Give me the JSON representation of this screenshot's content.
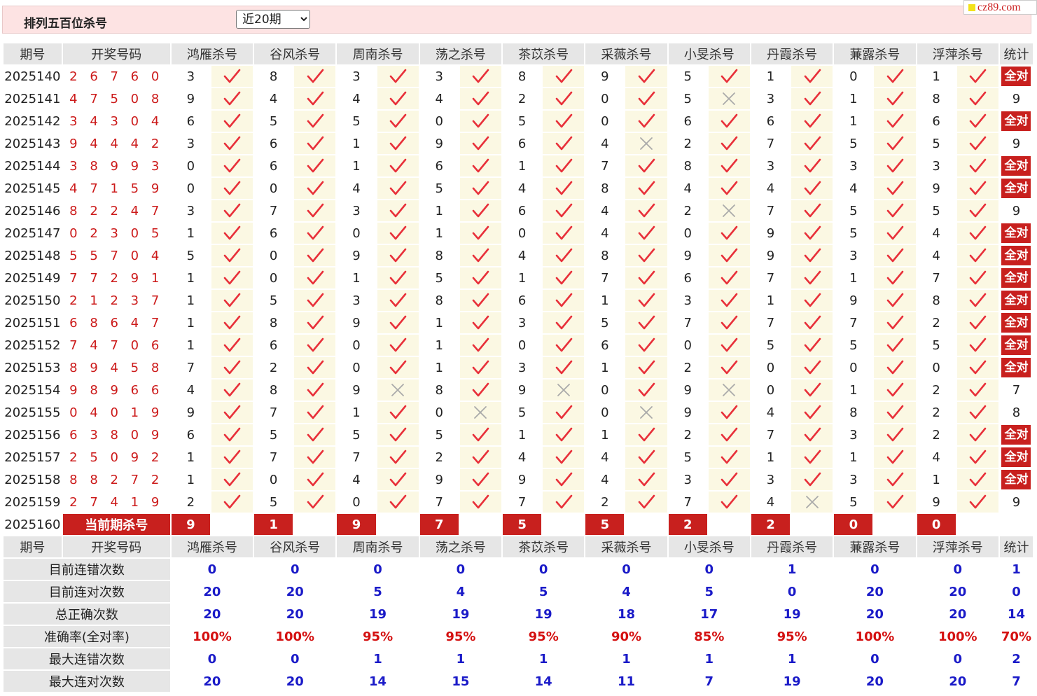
{
  "header": {
    "title": "排列五百位杀号",
    "period_select": "近20期"
  },
  "brand": "cz89.com",
  "columns": {
    "period": "期号",
    "draw": "开奖号码",
    "experts": [
      "鸿雁杀号",
      "谷风杀号",
      "周南杀号",
      "荡之杀号",
      "茶苡杀号",
      "采薇杀号",
      "小旻杀号",
      "丹霞杀号",
      "蒹露杀号",
      "浮萍杀号"
    ],
    "stat": "统计"
  },
  "rows": [
    {
      "period": "2025140",
      "draw": "2 6 7 6 0",
      "kills": [
        "3",
        "8",
        "3",
        "3",
        "8",
        "9",
        "5",
        "1",
        "0",
        "1"
      ],
      "hits": [
        1,
        1,
        1,
        1,
        1,
        1,
        1,
        1,
        1,
        1
      ],
      "stat": "全对"
    },
    {
      "period": "2025141",
      "draw": "4 7 5 0 8",
      "kills": [
        "9",
        "4",
        "4",
        "4",
        "2",
        "0",
        "5",
        "3",
        "1",
        "8"
      ],
      "hits": [
        1,
        1,
        1,
        1,
        1,
        1,
        0,
        1,
        1,
        1
      ],
      "stat": "9"
    },
    {
      "period": "2025142",
      "draw": "3 4 3 0 4",
      "kills": [
        "6",
        "5",
        "5",
        "0",
        "5",
        "0",
        "6",
        "6",
        "1",
        "6"
      ],
      "hits": [
        1,
        1,
        1,
        1,
        1,
        1,
        1,
        1,
        1,
        1
      ],
      "stat": "全对"
    },
    {
      "period": "2025143",
      "draw": "9 4 4 4 2",
      "kills": [
        "3",
        "6",
        "1",
        "9",
        "6",
        "4",
        "2",
        "7",
        "5",
        "5"
      ],
      "hits": [
        1,
        1,
        1,
        1,
        1,
        0,
        1,
        1,
        1,
        1
      ],
      "stat": "9"
    },
    {
      "period": "2025144",
      "draw": "3 8 9 9 3",
      "kills": [
        "0",
        "6",
        "1",
        "6",
        "1",
        "7",
        "8",
        "3",
        "3",
        "3"
      ],
      "hits": [
        1,
        1,
        1,
        1,
        1,
        1,
        1,
        1,
        1,
        1
      ],
      "stat": "全对"
    },
    {
      "period": "2025145",
      "draw": "4 7 1 5 9",
      "kills": [
        "0",
        "0",
        "4",
        "5",
        "4",
        "8",
        "4",
        "4",
        "4",
        "9"
      ],
      "hits": [
        1,
        1,
        1,
        1,
        1,
        1,
        1,
        1,
        1,
        1
      ],
      "stat": "全对"
    },
    {
      "period": "2025146",
      "draw": "8 2 2 4 7",
      "kills": [
        "3",
        "7",
        "3",
        "1",
        "6",
        "4",
        "2",
        "7",
        "5",
        "5"
      ],
      "hits": [
        1,
        1,
        1,
        1,
        1,
        1,
        0,
        1,
        1,
        1
      ],
      "stat": "9"
    },
    {
      "period": "2025147",
      "draw": "0 2 3 0 5",
      "kills": [
        "1",
        "6",
        "0",
        "1",
        "0",
        "4",
        "0",
        "9",
        "5",
        "4"
      ],
      "hits": [
        1,
        1,
        1,
        1,
        1,
        1,
        1,
        1,
        1,
        1
      ],
      "stat": "全对"
    },
    {
      "period": "2025148",
      "draw": "5 5 7 0 4",
      "kills": [
        "5",
        "0",
        "9",
        "8",
        "4",
        "8",
        "9",
        "9",
        "3",
        "4"
      ],
      "hits": [
        1,
        1,
        1,
        1,
        1,
        1,
        1,
        1,
        1,
        1
      ],
      "stat": "全对"
    },
    {
      "period": "2025149",
      "draw": "7 7 2 9 1",
      "kills": [
        "1",
        "0",
        "1",
        "5",
        "1",
        "7",
        "6",
        "7",
        "1",
        "7"
      ],
      "hits": [
        1,
        1,
        1,
        1,
        1,
        1,
        1,
        1,
        1,
        1
      ],
      "stat": "全对"
    },
    {
      "period": "2025150",
      "draw": "2 1 2 3 7",
      "kills": [
        "1",
        "5",
        "3",
        "8",
        "6",
        "1",
        "3",
        "1",
        "9",
        "8"
      ],
      "hits": [
        1,
        1,
        1,
        1,
        1,
        1,
        1,
        1,
        1,
        1
      ],
      "stat": "全对"
    },
    {
      "period": "2025151",
      "draw": "6 8 6 4 7",
      "kills": [
        "1",
        "8",
        "9",
        "1",
        "3",
        "5",
        "7",
        "7",
        "7",
        "2"
      ],
      "hits": [
        1,
        1,
        1,
        1,
        1,
        1,
        1,
        1,
        1,
        1
      ],
      "stat": "全对"
    },
    {
      "period": "2025152",
      "draw": "7 4 7 0 6",
      "kills": [
        "1",
        "6",
        "0",
        "1",
        "0",
        "6",
        "0",
        "5",
        "5",
        "5"
      ],
      "hits": [
        1,
        1,
        1,
        1,
        1,
        1,
        1,
        1,
        1,
        1
      ],
      "stat": "全对"
    },
    {
      "period": "2025153",
      "draw": "8 9 4 5 8",
      "kills": [
        "7",
        "2",
        "0",
        "1",
        "3",
        "1",
        "2",
        "0",
        "0",
        "0"
      ],
      "hits": [
        1,
        1,
        1,
        1,
        1,
        1,
        1,
        1,
        1,
        1
      ],
      "stat": "全对"
    },
    {
      "period": "2025154",
      "draw": "9 8 9 6 6",
      "kills": [
        "4",
        "8",
        "9",
        "8",
        "9",
        "0",
        "9",
        "0",
        "1",
        "2"
      ],
      "hits": [
        1,
        1,
        0,
        1,
        0,
        1,
        0,
        1,
        1,
        1
      ],
      "stat": "7"
    },
    {
      "period": "2025155",
      "draw": "0 4 0 1 9",
      "kills": [
        "9",
        "7",
        "1",
        "0",
        "5",
        "0",
        "9",
        "4",
        "8",
        "2"
      ],
      "hits": [
        1,
        1,
        1,
        0,
        1,
        0,
        1,
        1,
        1,
        1
      ],
      "stat": "8"
    },
    {
      "period": "2025156",
      "draw": "6 3 8 0 9",
      "kills": [
        "6",
        "5",
        "5",
        "5",
        "1",
        "1",
        "2",
        "7",
        "3",
        "2"
      ],
      "hits": [
        1,
        1,
        1,
        1,
        1,
        1,
        1,
        1,
        1,
        1
      ],
      "stat": "全对"
    },
    {
      "period": "2025157",
      "draw": "2 5 0 9 2",
      "kills": [
        "1",
        "7",
        "7",
        "2",
        "4",
        "4",
        "5",
        "1",
        "1",
        "4"
      ],
      "hits": [
        1,
        1,
        1,
        1,
        1,
        1,
        1,
        1,
        1,
        1
      ],
      "stat": "全对"
    },
    {
      "period": "2025158",
      "draw": "8 8 2 7 2",
      "kills": [
        "1",
        "0",
        "4",
        "9",
        "9",
        "4",
        "3",
        "3",
        "3",
        "1"
      ],
      "hits": [
        1,
        1,
        1,
        1,
        1,
        1,
        1,
        1,
        1,
        1
      ],
      "stat": "全对"
    },
    {
      "period": "2025159",
      "draw": "2 7 4 1 9",
      "kills": [
        "2",
        "5",
        "0",
        "7",
        "7",
        "2",
        "7",
        "4",
        "5",
        "9"
      ],
      "hits": [
        1,
        1,
        1,
        1,
        1,
        1,
        1,
        0,
        1,
        1
      ],
      "stat": "9"
    }
  ],
  "current": {
    "period": "2025160",
    "label": "当前期杀号",
    "kills": [
      "9",
      "1",
      "9",
      "7",
      "5",
      "5",
      "2",
      "2",
      "0",
      "0"
    ]
  },
  "summary": [
    {
      "label": "目前连错次数",
      "values": [
        "0",
        "0",
        "0",
        "0",
        "0",
        "0",
        "0",
        "1",
        "0",
        "0"
      ],
      "stat": "1",
      "pct": false
    },
    {
      "label": "目前连对次数",
      "values": [
        "20",
        "20",
        "5",
        "4",
        "5",
        "4",
        "5",
        "0",
        "20",
        "20"
      ],
      "stat": "0",
      "pct": false
    },
    {
      "label": "总正确次数",
      "values": [
        "20",
        "20",
        "19",
        "19",
        "19",
        "18",
        "17",
        "19",
        "20",
        "20"
      ],
      "stat": "14",
      "pct": false
    },
    {
      "label": "准确率(全对率)",
      "values": [
        "100%",
        "100%",
        "95%",
        "95%",
        "95%",
        "90%",
        "85%",
        "95%",
        "100%",
        "100%"
      ],
      "stat": "70%",
      "pct": true
    },
    {
      "label": "最大连错次数",
      "values": [
        "0",
        "0",
        "1",
        "1",
        "1",
        "1",
        "1",
        "1",
        "0",
        "0"
      ],
      "stat": "2",
      "pct": false
    },
    {
      "label": "最大连对次数",
      "values": [
        "20",
        "20",
        "14",
        "15",
        "14",
        "11",
        "7",
        "19",
        "20",
        "20"
      ],
      "stat": "7",
      "pct": false
    }
  ],
  "colors": {
    "accent_red": "#c8201e",
    "check_red": "#e8303a",
    "cross_gray": "#aaaaaa",
    "stat_blue": "#1a1ac8",
    "header_pink": "#fde3e3"
  },
  "icons": {
    "hit": "check-icon",
    "miss": "cross-icon"
  }
}
